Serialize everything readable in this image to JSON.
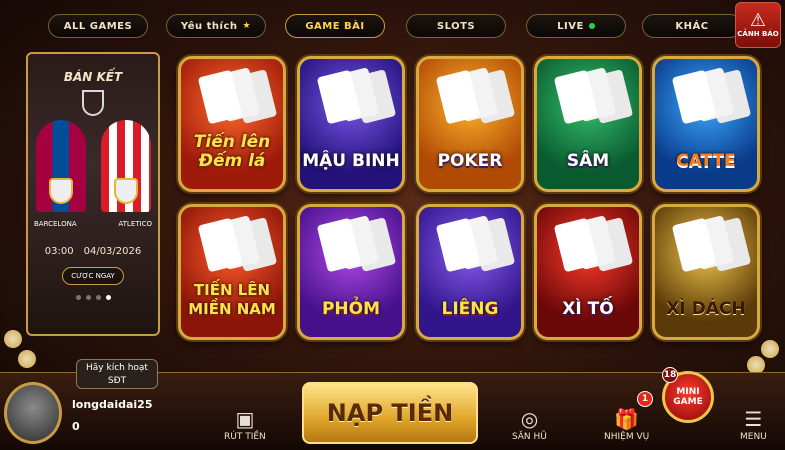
{
  "tabs": [
    {
      "label": "ALL GAMES"
    },
    {
      "label": "Yêu thích",
      "icon": "star-icon"
    },
    {
      "label": "GAME BÀI",
      "active": true
    },
    {
      "label": "SLOTS"
    },
    {
      "label": "LIVE",
      "indicator_color": "#21d34d"
    },
    {
      "label": "KHÁC"
    }
  ],
  "alert": {
    "label": "CẢNH BÁO",
    "icon": "warning-icon"
  },
  "match": {
    "stage": "BÁN KẾT",
    "home": "BARCELONA",
    "away": "ATLETICO",
    "time": "03:00",
    "date": "04/03/2026",
    "bet_label": "CƯỢC NGAY"
  },
  "games": [
    {
      "name": "Tiến lên\nĐếm lá"
    },
    {
      "name": "MẬU BINH"
    },
    {
      "name": "POKER"
    },
    {
      "name": "SÂM"
    },
    {
      "name": "CATTE"
    },
    {
      "name": "TIẾN LÊN\nMIỀN NAM"
    },
    {
      "name": "PHỎM"
    },
    {
      "name": "LIÊNG"
    },
    {
      "name": "XÌ TỐ"
    },
    {
      "name": "XÌ DÁCH"
    }
  ],
  "user": {
    "activate_label": "Hãy kích hoạt\nSĐT",
    "username": "longdaidai25",
    "balance": "0"
  },
  "bottom_nav": {
    "withdraw_label": "RÚT TIỀN",
    "deposit_label": "NẠP TIỀN",
    "jackpot_label": "SĂN HŨ",
    "mission_label": "NHIỆM VỤ",
    "mission_badge": "1",
    "mini_game_label": "MINI\nGAME",
    "mini_game_badge": "18",
    "menu_label": "MENU"
  },
  "colors": {
    "accent_gold": "#d8a93e",
    "alert_red": "#c92a1d"
  }
}
